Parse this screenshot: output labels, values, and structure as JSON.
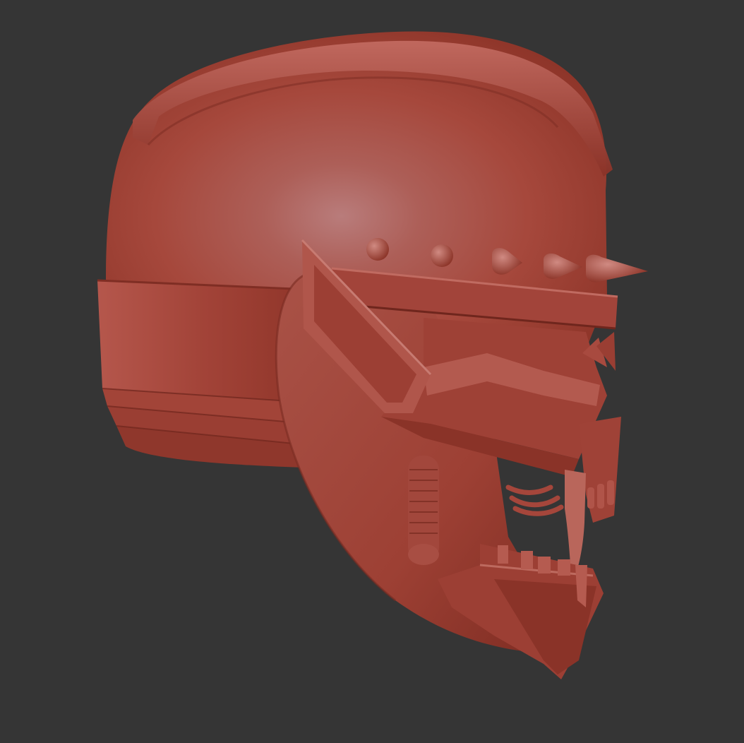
{
  "scene": {
    "background": "#353535",
    "model": "red-demon-helmet-sculpt",
    "material_colors": {
      "base": "#b14c40",
      "highlight": "#c98a88",
      "shadow": "#7a2a22",
      "mid": "#a2443a"
    },
    "spike_count": 5
  }
}
